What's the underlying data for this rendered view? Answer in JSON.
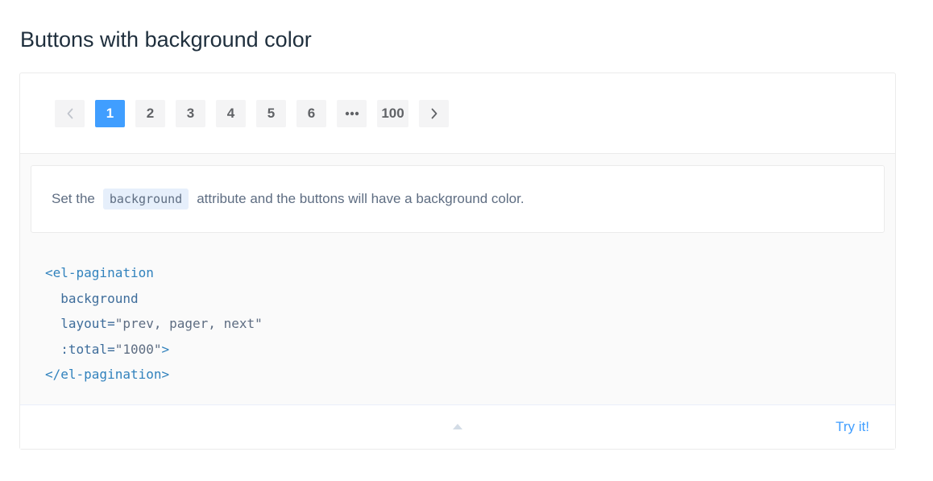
{
  "section": {
    "title": "Buttons with background color"
  },
  "pagination": {
    "prev_icon": "chevron-left-icon",
    "next_icon": "chevron-right-icon",
    "more_icon": "ellipsis-icon",
    "pages": [
      "1",
      "2",
      "3",
      "4",
      "5",
      "6"
    ],
    "last_page": "100",
    "active_page": "1"
  },
  "description": {
    "before": "Set the",
    "code": "background",
    "after": "attribute and the buttons will have a background color."
  },
  "code": {
    "line1": "<el-pagination",
    "line2": "background",
    "line3_attr": "layout=",
    "line3_val": "\"prev, pager, next\"",
    "line4_attr": ":total=",
    "line4_val": "\"1000\"",
    "line4_close": ">",
    "line5": "</el-pagination>"
  },
  "control": {
    "collapse_icon": "caret-up-icon",
    "try_label": "Try it!"
  },
  "colors": {
    "accent": "#409eff",
    "button_bg": "#f4f4f5"
  }
}
